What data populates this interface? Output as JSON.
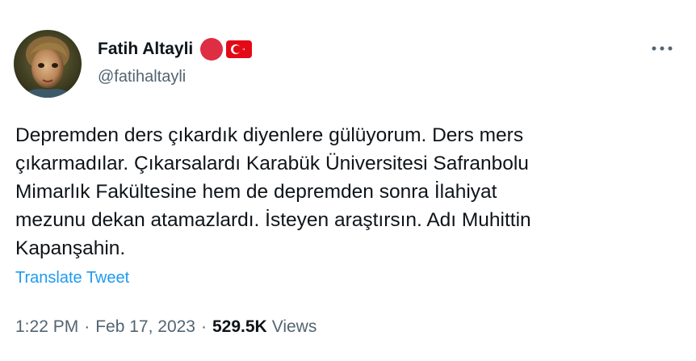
{
  "author": {
    "display_name": "Fatih Altayli",
    "handle": "@fatihaltayli",
    "name_icons": [
      "red-circle-icon",
      "turkey-flag-icon"
    ]
  },
  "tweet": {
    "text": "Depremden ders çıkardık diyenlere gülüyorum. Ders mers\nçıkarmadılar. Çıkarsalardı Karabük Üniversitesi Safranbolu\nMimarlık Fakültesine hem de depremden sonra İlahiyat\nmezunu dekan atamazlardı. İsteyen araştırsın. Adı Muhittin\nKapanşahin.",
    "translate_label": "Translate Tweet",
    "time": "1:22 PM",
    "separator": "·",
    "date": "Feb 17, 2023",
    "views_count": "529.5K",
    "views_label": "Views"
  },
  "colors": {
    "text_primary": "#0f1419",
    "text_secondary": "#536471",
    "link": "#1d9bf0",
    "red_circle": "#dd2e44",
    "flag_red": "#e30a17"
  }
}
